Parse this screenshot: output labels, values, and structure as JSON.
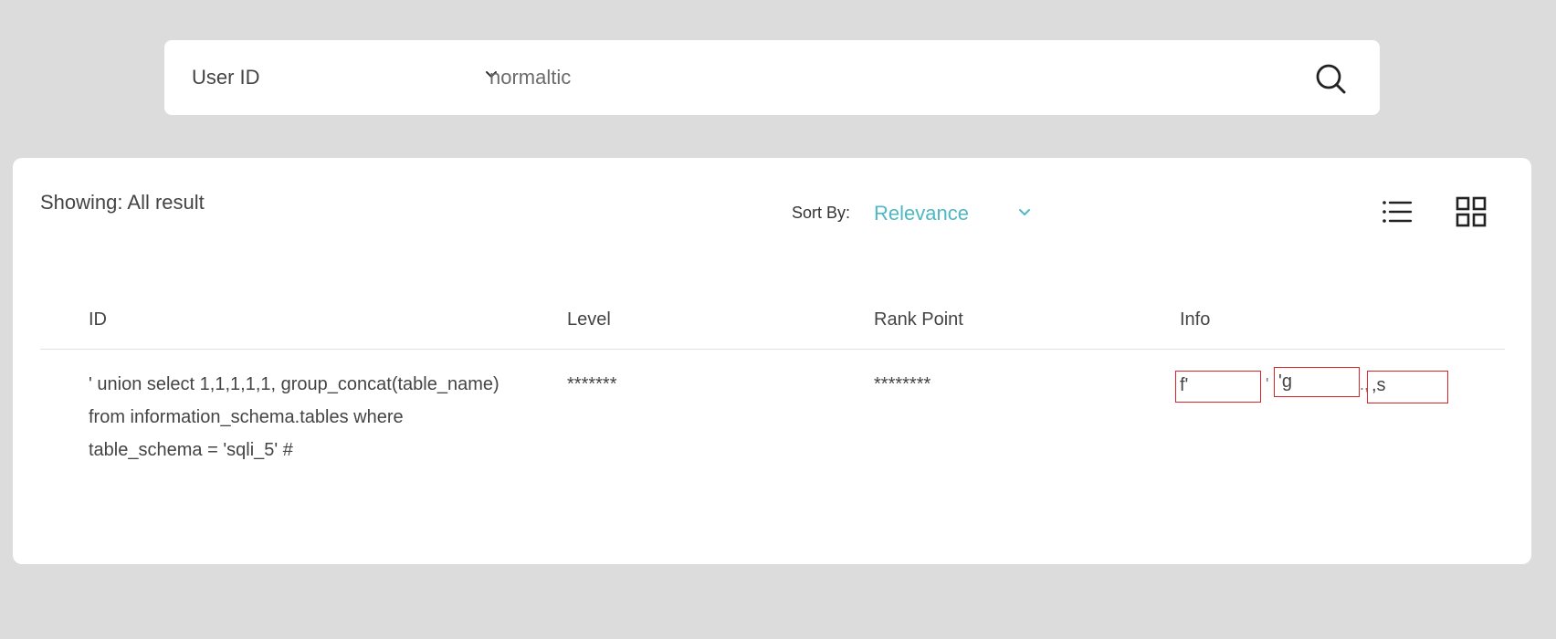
{
  "search": {
    "type_label": "User ID",
    "query": "normaltic"
  },
  "results": {
    "showing_text": "Showing: All result",
    "sort_label": "Sort By:",
    "sort_value": "Relevance",
    "columns": [
      "ID",
      "Level",
      "Rank Point",
      "Info"
    ],
    "rows": [
      {
        "id_lines": [
          "' union select 1,1,1,1,1, group_concat(table_name)",
          "from information_schema.tables where",
          "table_schema = 'sqli_5' #"
        ],
        "level": "*******",
        "rank_point": "********",
        "info_parts": [
          "f'",
          "'g",
          ",s"
        ],
        "info_separators": [
          "'",
          ".,"
        ]
      }
    ]
  },
  "colors": {
    "background": "#dcdcdc",
    "accent": "#4fb8c4",
    "highlight_box": "#d9242a"
  },
  "icons": {
    "type_dropdown": "chevron-down-icon",
    "search": "search-icon",
    "sort_dropdown": "chevron-down-icon",
    "list_view": "list-view-icon",
    "grid_view": "grid-view-icon"
  }
}
